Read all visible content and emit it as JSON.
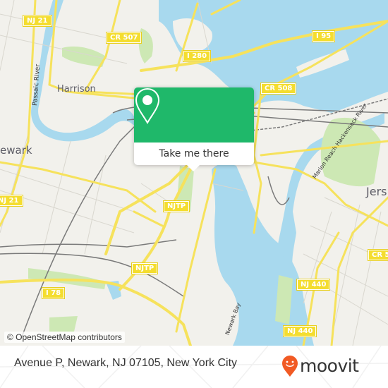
{
  "map": {
    "attribution": "© OpenStreetMap contributors",
    "place_labels": [
      {
        "name": "harrison",
        "text": "Harrison"
      },
      {
        "name": "newark",
        "text": "ewark"
      },
      {
        "name": "jersey",
        "text": "Jers"
      }
    ],
    "water_labels": [
      {
        "name": "passaic-river",
        "text": "Passaic River"
      },
      {
        "name": "hackensack-river",
        "text": "Marion Reach Hackensack River"
      },
      {
        "name": "newark-bay",
        "text": "Newark Bay"
      }
    ],
    "road_shields": [
      {
        "name": "nj21-north",
        "text": "NJ 21"
      },
      {
        "name": "cr507",
        "text": "CR 507"
      },
      {
        "name": "i280",
        "text": "I 280"
      },
      {
        "name": "i95",
        "text": "I 95"
      },
      {
        "name": "cr508",
        "text": "CR 508"
      },
      {
        "name": "nj21-south",
        "text": "NJ 21"
      },
      {
        "name": "njtp-north",
        "text": "NJTP"
      },
      {
        "name": "njtp-south",
        "text": "NJTP"
      },
      {
        "name": "i78",
        "text": "I 78"
      },
      {
        "name": "cr5xx",
        "text": "CR 5"
      },
      {
        "name": "nj440-north",
        "text": "NJ 440"
      },
      {
        "name": "nj440-south",
        "text": "NJ 440"
      }
    ],
    "colors": {
      "land": "#f2f1ec",
      "water": "#a8d9ee",
      "park": "#cde8b4",
      "road": "#f6e25c",
      "minor_road": "#d9d7cf",
      "rail": "#7a7a7a"
    }
  },
  "popup": {
    "icon": "map-pin-icon",
    "button_label": "Take me there",
    "accent_color": "#1fb86a"
  },
  "footer": {
    "address": "Avenue P, Newark, NJ 07105, New York City",
    "brand": "moovit",
    "brand_color": "#f15a24"
  }
}
